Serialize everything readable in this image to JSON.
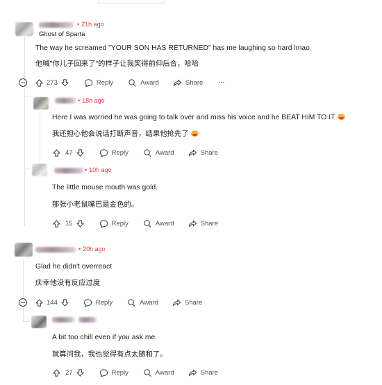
{
  "comments": [
    {
      "time": "21h ago",
      "flair": "Ghost of Sparta",
      "text_en": "The way he screamed \"YOUR SON HAS RETURNED\" has me laughing so hard lmao",
      "text_zh": "他喊\"你儿子回来了\"的样子让我笑得前仰后合，哈哈",
      "votes": "273",
      "reply": "Reply",
      "award": "Award",
      "share": "Share",
      "more": "···"
    },
    {
      "time": "18h ago",
      "text_en": "Here I was worried he was going to talk over and miss his voice and he BEAT HIM TO IT",
      "text_zh": "我还担心他会说话打断声音，结果他抢先了",
      "votes": "47",
      "reply": "Reply",
      "award": "Award",
      "share": "Share"
    },
    {
      "time": "10h ago",
      "text_en": "The little mouse mouth was gold.",
      "text_zh": "那张小老鼠嘴巴是金色的。",
      "votes": "15",
      "reply": "Reply",
      "award": "Award",
      "share": "Share"
    },
    {
      "time": "20h ago",
      "text_en": "Glad he didn't overreact",
      "text_zh": "庆幸他没有反应过度",
      "votes": "144",
      "reply": "Reply",
      "award": "Award",
      "share": "Share"
    },
    {
      "text_en": "A bit too chill even if you ask me.",
      "text_zh": "就算问我，我也觉得有点太随和了。",
      "votes": "27",
      "reply": "Reply",
      "award": "Award",
      "share": "Share"
    }
  ],
  "icons": {
    "upvote": "arrow-up-icon",
    "downvote": "arrow-down-icon",
    "reply": "speech-bubble-icon",
    "award": "award-icon",
    "share": "share-arrow-icon",
    "collapse": "collapse-minus-icon"
  },
  "colors": {
    "timestamp": "#e03b3b",
    "thread_line": "#e0e3e6",
    "text": "#1c1c1c",
    "action_text": "#4a4f54"
  }
}
